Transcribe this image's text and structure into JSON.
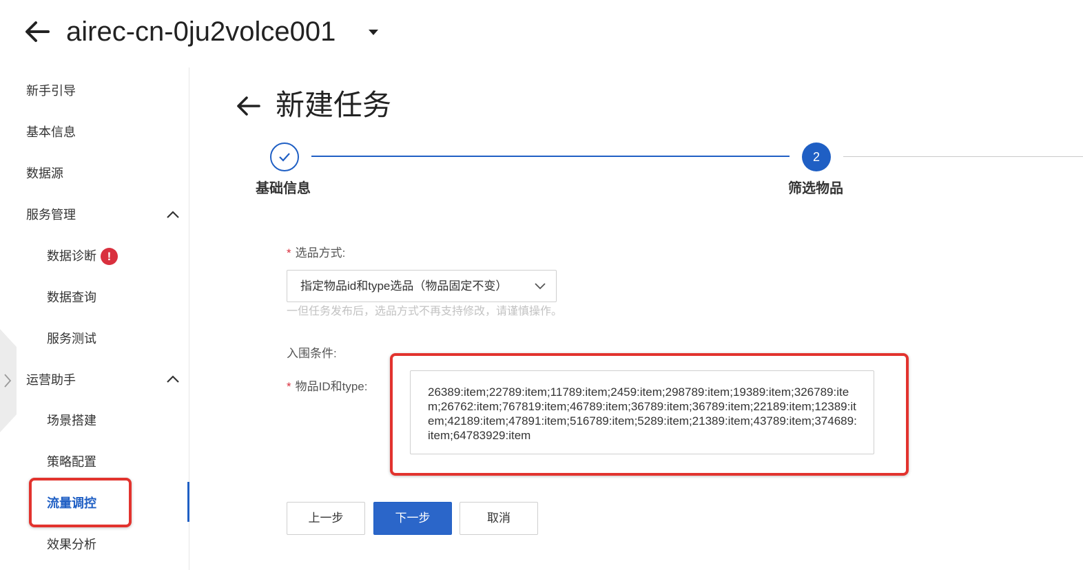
{
  "header": {
    "instance_name": "airec-cn-0ju2volce001",
    "back_icon": "arrow-left-icon",
    "dropdown_icon": "caret-down-icon"
  },
  "sidebar": {
    "items": [
      {
        "label": "新手引导",
        "level": "top"
      },
      {
        "label": "基本信息",
        "level": "top"
      },
      {
        "label": "数据源",
        "level": "top"
      },
      {
        "label": "服务管理",
        "level": "top",
        "expanded": true
      },
      {
        "label": "数据诊断",
        "level": "sub",
        "badge": "!"
      },
      {
        "label": "数据查询",
        "level": "sub"
      },
      {
        "label": "服务测试",
        "level": "sub"
      },
      {
        "label": "运营助手",
        "level": "top",
        "expanded": true
      },
      {
        "label": "场景搭建",
        "level": "sub"
      },
      {
        "label": "策略配置",
        "level": "sub"
      },
      {
        "label": "流量调控",
        "level": "sub",
        "active": true
      },
      {
        "label": "效果分析",
        "level": "sub"
      }
    ]
  },
  "page": {
    "title": "新建任务"
  },
  "steps": [
    {
      "label": "基础信息",
      "state": "done",
      "icon": "check-icon"
    },
    {
      "label": "筛选物品",
      "state": "current",
      "number": "2"
    }
  ],
  "form": {
    "method_label": "选品方式:",
    "method_value": "指定物品id和type选品（物品固定不变）",
    "method_help": "一但任务发布后，选品方式不再支持修改，请谨慎操作。",
    "section_label": "入围条件:",
    "items_label": "物品ID和type:",
    "items_value": "26389:item;22789:item;11789:item;2459:item;298789:item;19389:item;326789:item;26762:item;767819:item;46789:item;36789:item;36789:item;22189:item;12389:item;42189:item;47891:item;516789:item;5289:item;21389:item;43789:item;374689:item;64783929:item",
    "required_mark": "*"
  },
  "buttons": {
    "prev": "上一步",
    "next": "下一步",
    "cancel": "取消"
  },
  "colors": {
    "primary": "#1f5fc4",
    "highlight": "#e2332e",
    "alert": "#d9303e"
  }
}
